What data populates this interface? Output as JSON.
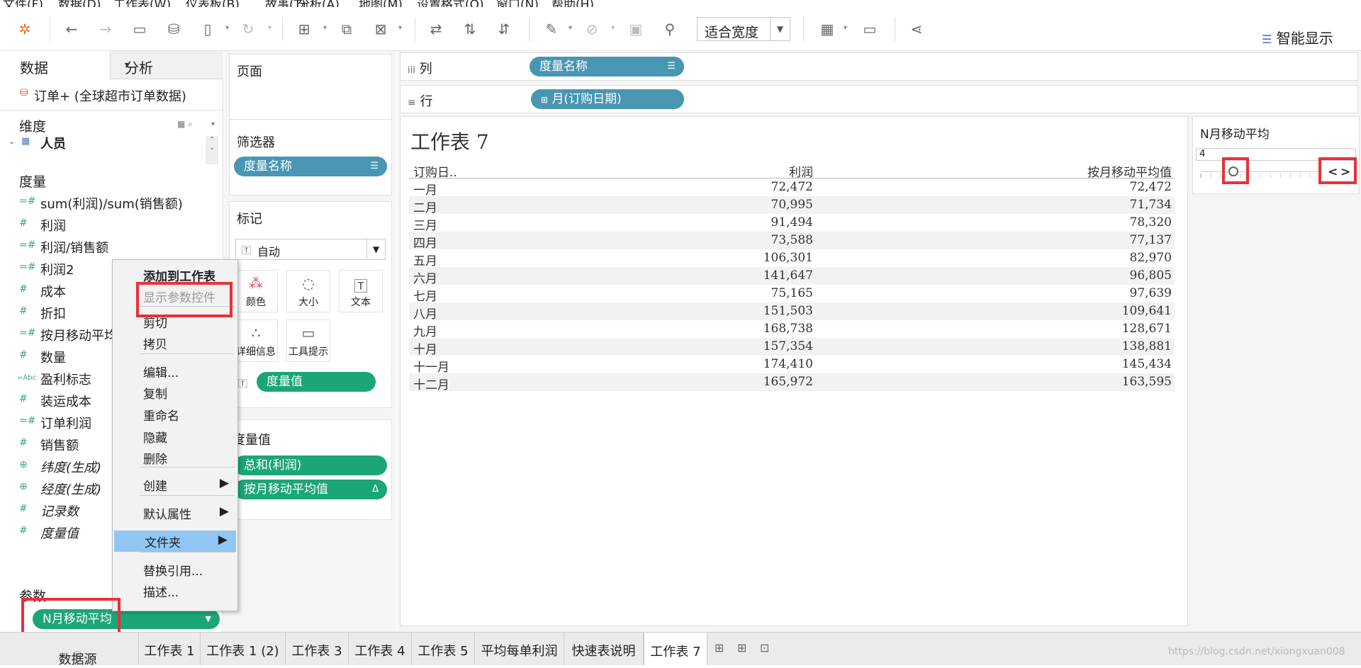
{
  "menubar": [
    "文件(F)",
    "数据(D)",
    "工作表(W)",
    "仪表板(B)",
    "故事(T)",
    "分析(A)",
    "地图(M)",
    "设置格式(O)",
    "窗口(N)",
    "帮助(H)"
  ],
  "toolbar": {
    "fit_label": "适合宽度",
    "show_me_label": "智能显示",
    "icons": [
      "tableau-logo-icon",
      "undo-icon",
      "redo-icon",
      "save-icon",
      "new-datasource-icon",
      "pause-update-icon",
      "refresh-icon",
      "new-sheet-icon",
      "duplicate-sheet-icon",
      "clear-sheet-icon",
      "swap-icon",
      "sort-asc-icon",
      "sort-desc-icon",
      "highlight-icon",
      "group-icon",
      "label-icon",
      "pin-icon",
      "show-cards-icon",
      "presentation-icon",
      "share-icon"
    ]
  },
  "data_pane": {
    "tab_data": "数据",
    "tab_analysis": "分析",
    "datasource": "订单+ (全球超市订单数据)",
    "dimensions_header": "维度",
    "dimension_items": [
      "人员"
    ],
    "measures_header": "度量",
    "measures": [
      {
        "name": "sum(利润)/sum(销售额)",
        "icon": "calc-measure-icon",
        "italic": false
      },
      {
        "name": "利润",
        "icon": "number-icon",
        "italic": false
      },
      {
        "name": "利润/销售额",
        "icon": "calc-measure-icon",
        "italic": false
      },
      {
        "name": "利润2",
        "icon": "calc-measure-icon",
        "italic": false
      },
      {
        "name": "成本",
        "icon": "number-icon",
        "italic": false
      },
      {
        "name": "折扣",
        "icon": "number-icon",
        "italic": false
      },
      {
        "name": "按月移动平均值",
        "icon": "calc-measure-icon",
        "italic": false
      },
      {
        "name": "数量",
        "icon": "number-icon",
        "italic": false
      },
      {
        "name": "盈利标志",
        "icon": "abc-icon",
        "italic": false
      },
      {
        "name": "装运成本",
        "icon": "number-icon",
        "italic": false
      },
      {
        "name": "订单利润",
        "icon": "calc-measure-icon",
        "italic": false
      },
      {
        "name": "销售额",
        "icon": "number-icon",
        "italic": false
      },
      {
        "name": "纬度(生成)",
        "icon": "globe-icon",
        "italic": true
      },
      {
        "name": "经度(生成)",
        "icon": "globe-icon",
        "italic": true
      },
      {
        "name": "记录数",
        "icon": "number-icon",
        "italic": true
      },
      {
        "name": "度量值",
        "icon": "number-icon",
        "italic": true
      }
    ],
    "params_header": "参数",
    "param_pill": "N月移动平均"
  },
  "shelves": {
    "pages_title": "页面",
    "filters_title": "筛选器",
    "filter_pill": "度量名称",
    "marks_title": "标记",
    "marks_type": "自动",
    "mark_buttons": [
      {
        "label": "颜色",
        "icon": "color-icon"
      },
      {
        "label": "大小",
        "icon": "size-icon"
      },
      {
        "label": "文本",
        "icon": "text-icon"
      },
      {
        "label": "详细信息",
        "icon": "detail-icon"
      },
      {
        "label": "工具提示",
        "icon": "tooltip-icon"
      }
    ],
    "marks_text_pill": "度量值",
    "measure_values_title": "度量值",
    "measure_value_pills": [
      "总和(利润)",
      "按月移动平均值"
    ],
    "columns_label": "列",
    "columns_pill": "度量名称",
    "rows_label": "行",
    "rows_pill": "月(订购日期)"
  },
  "sheet": {
    "title": "工作表 7",
    "headers": [
      "订购日..",
      "利润",
      "按月移动平均值"
    ],
    "rows": [
      [
        "一月",
        "72,472",
        "72,472"
      ],
      [
        "二月",
        "70,995",
        "71,734"
      ],
      [
        "三月",
        "91,494",
        "78,320"
      ],
      [
        "四月",
        "73,588",
        "77,137"
      ],
      [
        "五月",
        "106,301",
        "82,970"
      ],
      [
        "六月",
        "141,647",
        "96,805"
      ],
      [
        "七月",
        "75,165",
        "97,639"
      ],
      [
        "八月",
        "151,503",
        "109,641"
      ],
      [
        "九月",
        "168,738",
        "128,671"
      ],
      [
        "十月",
        "157,354",
        "138,881"
      ],
      [
        "十一月",
        "174,410",
        "145,434"
      ],
      [
        "十二月",
        "165,972",
        "163,595"
      ]
    ]
  },
  "param_control": {
    "title": "N月移动平均",
    "value": "4"
  },
  "context_menu": {
    "items": [
      {
        "label": "添加到工作表",
        "bold": true,
        "disabled": false,
        "submenu": false,
        "highlight": false
      },
      {
        "label": "显示参数控件",
        "bold": false,
        "disabled": true,
        "submenu": false,
        "highlight": false
      },
      {
        "label": "剪切",
        "bold": false,
        "disabled": false,
        "submenu": false,
        "highlight": false
      },
      {
        "label": "拷贝",
        "bold": false,
        "disabled": false,
        "submenu": false,
        "highlight": false
      },
      {
        "label": "编辑...",
        "bold": false,
        "disabled": false,
        "submenu": false,
        "highlight": false
      },
      {
        "label": "复制",
        "bold": false,
        "disabled": false,
        "submenu": false,
        "highlight": false
      },
      {
        "label": "重命名",
        "bold": false,
        "disabled": false,
        "submenu": false,
        "highlight": false
      },
      {
        "label": "隐藏",
        "bold": false,
        "disabled": false,
        "submenu": false,
        "highlight": false
      },
      {
        "label": "删除",
        "bold": false,
        "disabled": false,
        "submenu": false,
        "highlight": false
      },
      {
        "label": "创建",
        "bold": false,
        "disabled": false,
        "submenu": true,
        "highlight": false
      },
      {
        "label": "默认属性",
        "bold": false,
        "disabled": false,
        "submenu": true,
        "highlight": false
      },
      {
        "label": "文件夹",
        "bold": false,
        "disabled": false,
        "submenu": true,
        "highlight": true
      },
      {
        "label": "替换引用...",
        "bold": false,
        "disabled": false,
        "submenu": false,
        "highlight": false
      },
      {
        "label": "描述...",
        "bold": false,
        "disabled": false,
        "submenu": false,
        "highlight": false
      }
    ]
  },
  "bottom_tabs": {
    "datasource_tab": "数据源",
    "sheets": [
      "工作表 1",
      "工作表 1 (2)",
      "工作表 3",
      "工作表 4",
      "工作表 5",
      "平均每单利润",
      "快速表说明",
      "工作表 7"
    ],
    "active_sheet": "工作表 7"
  },
  "watermark": "https://blog.csdn.net/xiongxuan008",
  "colors": {
    "pill_blue": "#4996b2",
    "pill_green": "#1ba678",
    "highlight_red": "#e8313a",
    "menu_highlight": "#91c6f2"
  }
}
